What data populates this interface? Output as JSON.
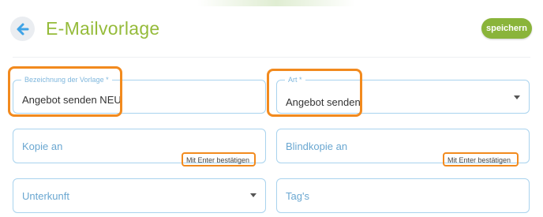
{
  "header": {
    "title": "E-Mailvorlage",
    "save_label": "speichern"
  },
  "form": {
    "bezeichnung": {
      "label": "Bezeichnung der Vorlage",
      "required_mark": "*",
      "value": "Angebot senden NEU"
    },
    "art": {
      "label": "Art",
      "required_mark": "*",
      "value": "Angebot senden"
    },
    "kopie": {
      "placeholder": "Kopie an",
      "hint": "Mit Enter bestätigen"
    },
    "blindkopie": {
      "placeholder": "Blindkopie an",
      "hint": "Mit Enter bestätigen"
    },
    "unterkunft": {
      "placeholder": "Unterkunft"
    },
    "tags": {
      "placeholder": "Tag's"
    }
  },
  "colors": {
    "title_green": "#95bb3a",
    "button_green": "#8ab43a",
    "field_border": "#a9d3ee",
    "label_blue": "#6aa7d1",
    "highlight_orange": "#f28a1e"
  },
  "icons": {
    "back": "arrow-left-icon",
    "dropdown": "caret-down-icon"
  }
}
